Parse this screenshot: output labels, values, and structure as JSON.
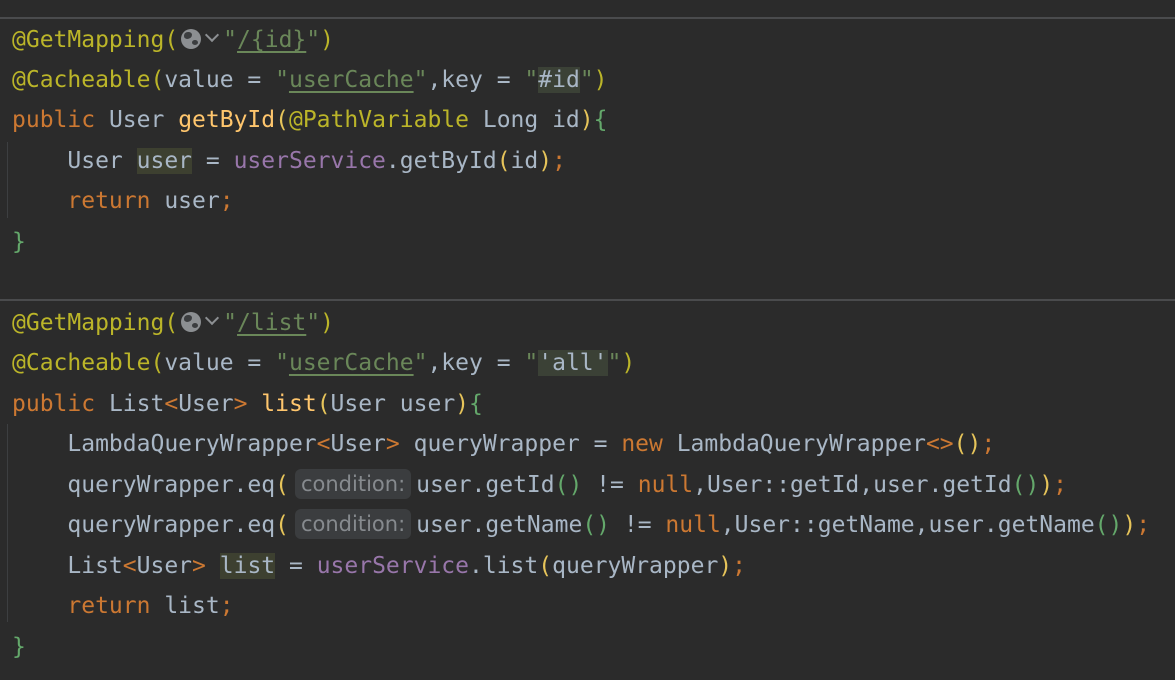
{
  "block1": {
    "annotation_get": "@GetMapping(",
    "path": "/{id}",
    "annotation_cache": "@Cacheable(",
    "cache_value_key": "value = ",
    "cache_name": "userCache",
    "cache_key_label": ",key = ",
    "cache_key_hash": "#",
    "cache_key_id": "id",
    "close_paren": ")",
    "public_kw": "public ",
    "return_type": "User ",
    "method_name": "getById",
    "open_paren": "(",
    "param_ann": "@PathVariable",
    "param_type": " Long id",
    "close_brace_open": "){",
    "stmt1_type": "User ",
    "stmt1_var": "user",
    "stmt1_eq": " = ",
    "stmt1_field": "userService",
    "stmt1_call": ".getById",
    "stmt1_args": "(id)",
    "semicolon": ";",
    "return_kw": "return ",
    "return_val": "user",
    "end_brace": "}"
  },
  "block2": {
    "annotation_get": "@GetMapping(",
    "path": "/list",
    "annotation_cache": "@Cacheable(",
    "cache_value_key": "value = ",
    "cache_name": "userCache",
    "cache_key_label": ",key = ",
    "cache_key_all": "'all'",
    "close_paren": ")",
    "public_kw": "public ",
    "return_type_list": "List",
    "return_type_generic": "<User>",
    "method_name": "list",
    "params": "(User user)",
    "open_brace": "{",
    "wrapper_type": "LambdaQueryWrapper",
    "wrapper_generic": "<User>",
    "wrapper_var": " queryWrapper = ",
    "new_kw": "new ",
    "wrapper_ctor": "LambdaQueryWrapper",
    "diamond": "<>",
    "ctor_parens": "()",
    "eq_call": "queryWrapper.eq",
    "condition_hint": "condition:",
    "eq1_expr": "user.getId",
    "eq1_rest": " != ",
    "null_kw": "null",
    "eq1_ref": ",User::getId,user.getId",
    "eq2_expr": "user.getName",
    "eq2_ref": ",User::getName,user.getName",
    "list_stmt_type": "List",
    "list_stmt_generic": "<User>",
    "list_var": "list",
    "list_eq": " = ",
    "list_field": "userService",
    "list_call": ".list",
    "list_args": "(queryWrapper)",
    "return_kw": "return ",
    "return_val": "list",
    "end_brace": "}"
  },
  "colors": {
    "background": "#2b2b2b",
    "annotation": "#bbb529",
    "keyword": "#cc7832",
    "function": "#ffc66d",
    "string": "#6a8759",
    "field": "#9876aa",
    "default": "#a9b7c6"
  },
  "icons": {
    "web_endpoint": "globe-icon",
    "dropdown": "chevron-down-icon"
  }
}
